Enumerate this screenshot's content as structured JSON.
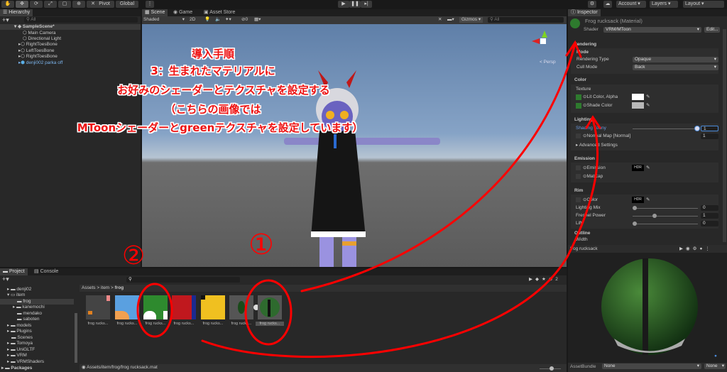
{
  "toolbar": {
    "pivot": "Pivot",
    "global": "Global",
    "account": "Account",
    "layers": "Layers",
    "layout": "Layout"
  },
  "hierarchy": {
    "tab": "Hierarchy",
    "search_placeholder": "All",
    "scene": "SampleScene*",
    "items": [
      "Main Camera",
      "Directional Light",
      "RightToesBone",
      "LeftToesBone",
      "RightToesBone",
      "denji002 parka off"
    ]
  },
  "scene": {
    "tabs": [
      "Scene",
      "Game",
      "Asset Store"
    ],
    "shading": "Shaded",
    "mode2d": "2D",
    "gizmos": "Gizmos",
    "search_placeholder": "All",
    "persp": "Persp",
    "hidden_count": "0"
  },
  "annotation": {
    "lines": [
      "導入手順",
      "3：生まれたマテリアルに",
      "お好みのシェーダーとテクスチャを設定する",
      "（こちらの画像では",
      "MToonシェーダーとgreenテクスチャを設定しています）"
    ],
    "num1": "①",
    "num2": "②"
  },
  "inspector": {
    "tab": "Inspector",
    "title": "Frog rucksack (Material)",
    "shader_label": "Shader",
    "shader": "VRM/MToon",
    "edit": "Edit...",
    "rendering": "Rendering",
    "mode": "Mode",
    "rendering_type_label": "Rendering Type",
    "rendering_type": "Opaque",
    "cull_mode_label": "Cull Mode",
    "cull_mode": "Back",
    "color": "Color",
    "texture": "Texture",
    "lit_color": "Lit Color, Alpha",
    "shade_color": "Shade Color",
    "lighting": "Lighting",
    "shading_toony": "Shading Toony",
    "shading_toony_value": "1",
    "normal_map": "Normal Map [Normal]",
    "normal_map_value": "1",
    "advanced": "Advanced Settings",
    "emission": "Emission",
    "emission_label": "Emission",
    "hdr": "HDR",
    "matcap": "MatCap",
    "rim": "Rim",
    "rim_color": "Color",
    "lighting_mix": "Lighting Mix",
    "lighting_mix_value": "0",
    "fresnel": "Fresnel Power",
    "fresnel_value": "1",
    "lift": "Lift",
    "lift_value": "0",
    "outline": "Outline",
    "width": "Width"
  },
  "preview": {
    "title": "frog rucksack",
    "assetbundle": "AssetBundle",
    "bundle": "None",
    "variant": "None"
  },
  "project": {
    "tabs": [
      "Project",
      "Console"
    ],
    "folders": [
      "denji02",
      "item",
      "frog",
      "kanemochi",
      "mendako",
      "saboten",
      "models",
      "Plugins",
      "Scenes",
      "Tomoya",
      "UniGLTF",
      "VRM",
      "VRMShaders",
      "Packages"
    ],
    "breadcrumb": [
      "Assets",
      "item",
      "frog"
    ],
    "hidden_count": "2",
    "assets": [
      "frog rucks...",
      "frog rucks...",
      "frog rucks...",
      "frog rucks...",
      "frog rucks...",
      "frog rucks...",
      "frog rucks..."
    ],
    "status_path": "Assets/item/frog/frog rucksack.mat"
  }
}
